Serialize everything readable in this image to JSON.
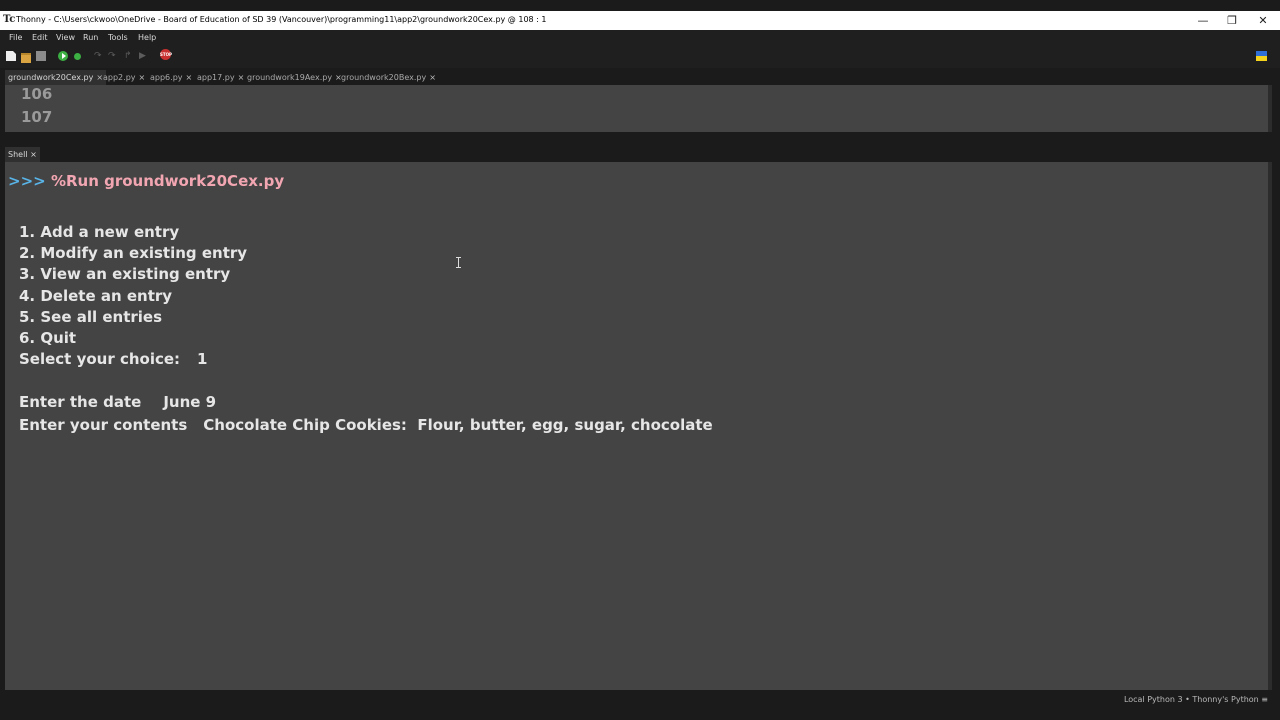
{
  "window": {
    "app_name": "Thonny",
    "title": "Thonny  -  C:\\Users\\ckwoo\\OneDrive - Board of Education of SD 39 (Vancouver)\\programming11\\app2\\groundwork20Cex.py  @  108 : 1",
    "minimize": "—",
    "restore": "❐",
    "close": "✕"
  },
  "menu": {
    "items": [
      "File",
      "Edit",
      "View",
      "Run",
      "Tools",
      "Help"
    ]
  },
  "toolbar": {
    "stop_label": "STOP"
  },
  "editor_tabs": [
    {
      "label": "groundwork20Cex.py",
      "close": "×"
    },
    {
      "label": "app2.py",
      "close": "×"
    },
    {
      "label": "app6.py",
      "close": "×"
    },
    {
      "label": "app17.py",
      "close": "×"
    },
    {
      "label": "groundwork19Aex.py",
      "close": "×"
    },
    {
      "label": "groundwork20Bex.py",
      "close": "×"
    }
  ],
  "editor": {
    "line_numbers": [
      "106",
      "107"
    ]
  },
  "shell": {
    "tab_label": "Shell",
    "tab_close": "×",
    "prompt": ">>>",
    "command": "%Run groundwork20Cex.py",
    "menu_lines": [
      "1. Add a new entry",
      "2. Modify an existing entry",
      "3. View an existing entry",
      "4. Delete an entry",
      "5. See all entries",
      "6. Quit"
    ],
    "select_prompt": "Select your choice:",
    "select_value": "1",
    "date_prompt": "Enter the date",
    "date_value": "June 9",
    "contents_prompt": "Enter your contents",
    "contents_value": "Chocolate Chip Cookies:  Flour, butter, egg, sugar, chocolate"
  },
  "status": {
    "text": "Local Python 3  •  Thonny's Python  ≡"
  }
}
